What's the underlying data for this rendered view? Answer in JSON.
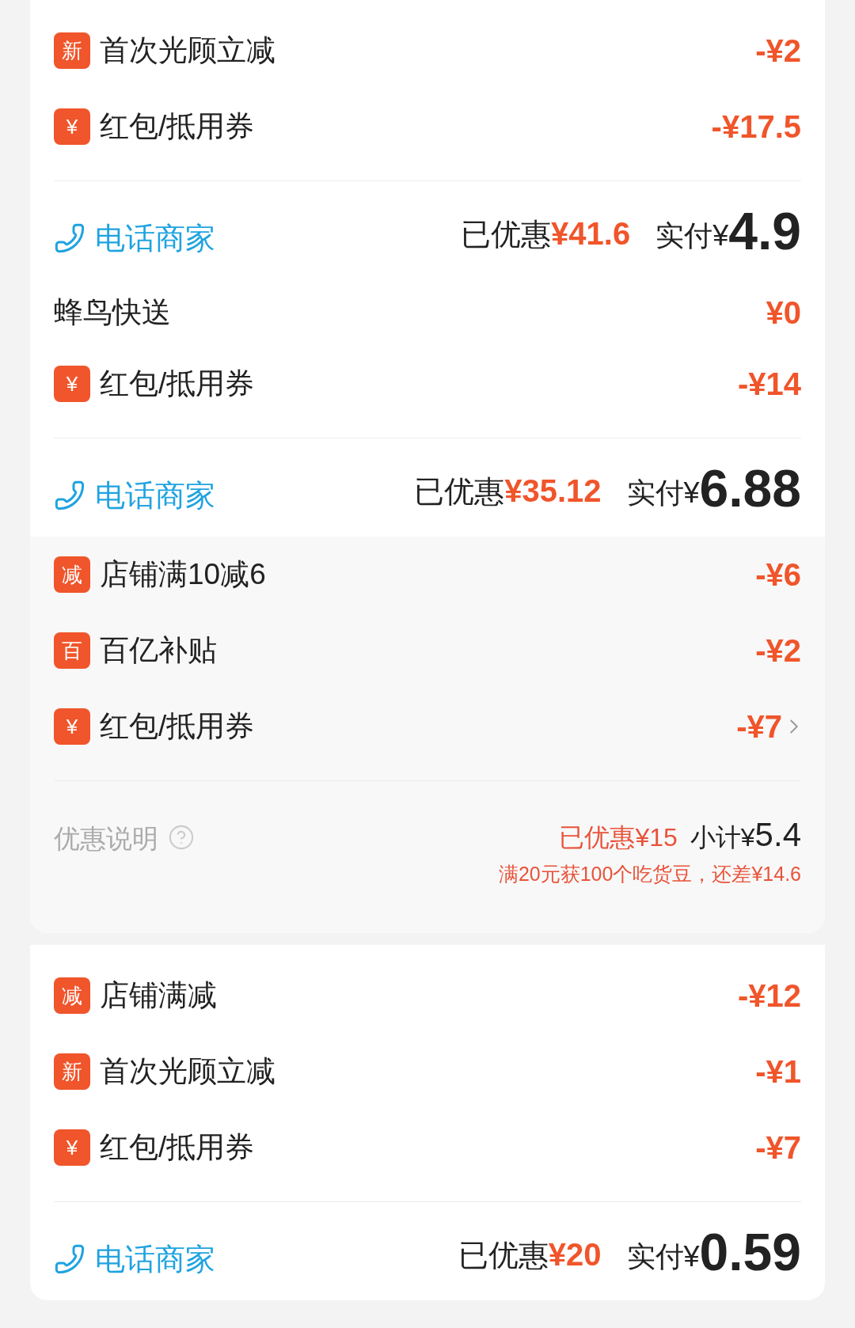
{
  "cards": [
    {
      "sections": [
        {
          "tinted": false,
          "rows": [
            {
              "kind": "discount",
              "badge": "新",
              "label": "首次光顾立减",
              "amount": "-¥2",
              "chevron": false
            },
            {
              "kind": "discount",
              "badge": "¥",
              "label": "红包/抵用券",
              "amount": "-¥17.5",
              "chevron": false
            },
            {
              "kind": "divider"
            },
            {
              "kind": "summary",
              "call_label": "电话商家",
              "saved_label": "已优惠",
              "saved": "¥41.6",
              "paid_label": "实付¥",
              "paid": "4.9"
            },
            {
              "kind": "plain",
              "label": "蜂鸟快送",
              "amount": "¥0"
            },
            {
              "kind": "discount",
              "badge": "¥",
              "label": "红包/抵用券",
              "amount": "-¥14",
              "chevron": false
            },
            {
              "kind": "divider"
            },
            {
              "kind": "summary",
              "call_label": "电话商家",
              "saved_label": "已优惠",
              "saved": "¥35.12",
              "paid_label": "实付¥",
              "paid": "6.88"
            }
          ]
        },
        {
          "tinted": true,
          "rows": [
            {
              "kind": "discount",
              "badge": "减",
              "label": "店铺满10减6",
              "amount": "-¥6",
              "chevron": false
            },
            {
              "kind": "discount",
              "badge": "百",
              "label": "百亿补贴",
              "amount": "-¥2",
              "chevron": false
            },
            {
              "kind": "discount",
              "badge": "¥",
              "label": "红包/抵用券",
              "amount": "-¥7",
              "chevron": true
            },
            {
              "kind": "divider"
            },
            {
              "kind": "note",
              "label": "优惠说明",
              "saved": "已优惠¥15",
              "subtotal_label": "小计¥",
              "subtotal": "5.4",
              "hint": "满20元获100个吃货豆，还差¥14.6"
            }
          ]
        }
      ]
    },
    {
      "sections": [
        {
          "tinted": false,
          "rows": [
            {
              "kind": "discount",
              "badge": "减",
              "label": "店铺满减",
              "amount": "-¥12",
              "chevron": false
            },
            {
              "kind": "discount",
              "badge": "新",
              "label": "首次光顾立减",
              "amount": "-¥1",
              "chevron": false
            },
            {
              "kind": "discount",
              "badge": "¥",
              "label": "红包/抵用券",
              "amount": "-¥7",
              "chevron": false
            },
            {
              "kind": "divider"
            },
            {
              "kind": "summary",
              "call_label": "电话商家",
              "saved_label": "已优惠",
              "saved": "¥20",
              "paid_label": "实付¥",
              "paid": "0.59"
            }
          ]
        }
      ]
    }
  ]
}
